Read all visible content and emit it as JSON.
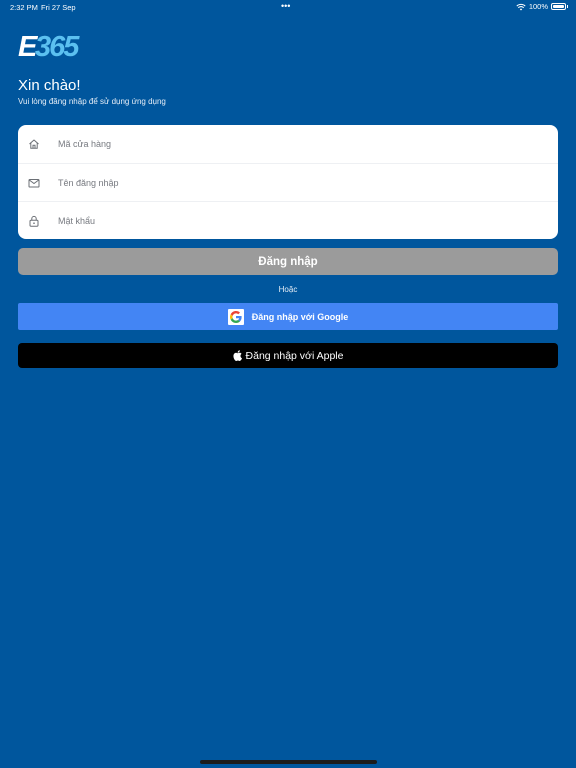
{
  "status_bar": {
    "time": "2:32 PM",
    "date": "Fri 27 Sep",
    "battery": "100%",
    "battery_level": 1.0
  },
  "logo": {
    "text": "E365"
  },
  "header": {
    "greeting": "Xin chào!",
    "subtitle": "Vui lòng đăng nhập để sử dụng ứng dụng"
  },
  "form": {
    "store_code": {
      "placeholder": "Mã cửa hàng",
      "value": "",
      "icon": "home-icon"
    },
    "username": {
      "placeholder": "Tên đăng nhập",
      "value": "",
      "icon": "mail-icon"
    },
    "password": {
      "placeholder": "Mật khẩu",
      "value": "",
      "icon": "lock-icon"
    }
  },
  "actions": {
    "login_label": "Đăng nhập",
    "or_label": "Hoặc",
    "google_label": "Đăng nhập với Google",
    "apple_label": "Đăng nhập với Apple"
  },
  "colors": {
    "background": "#00569d",
    "login_disabled": "#9b9b9b",
    "google": "#4385f4",
    "apple": "#000000",
    "logo_light": "#5bc0f0"
  }
}
